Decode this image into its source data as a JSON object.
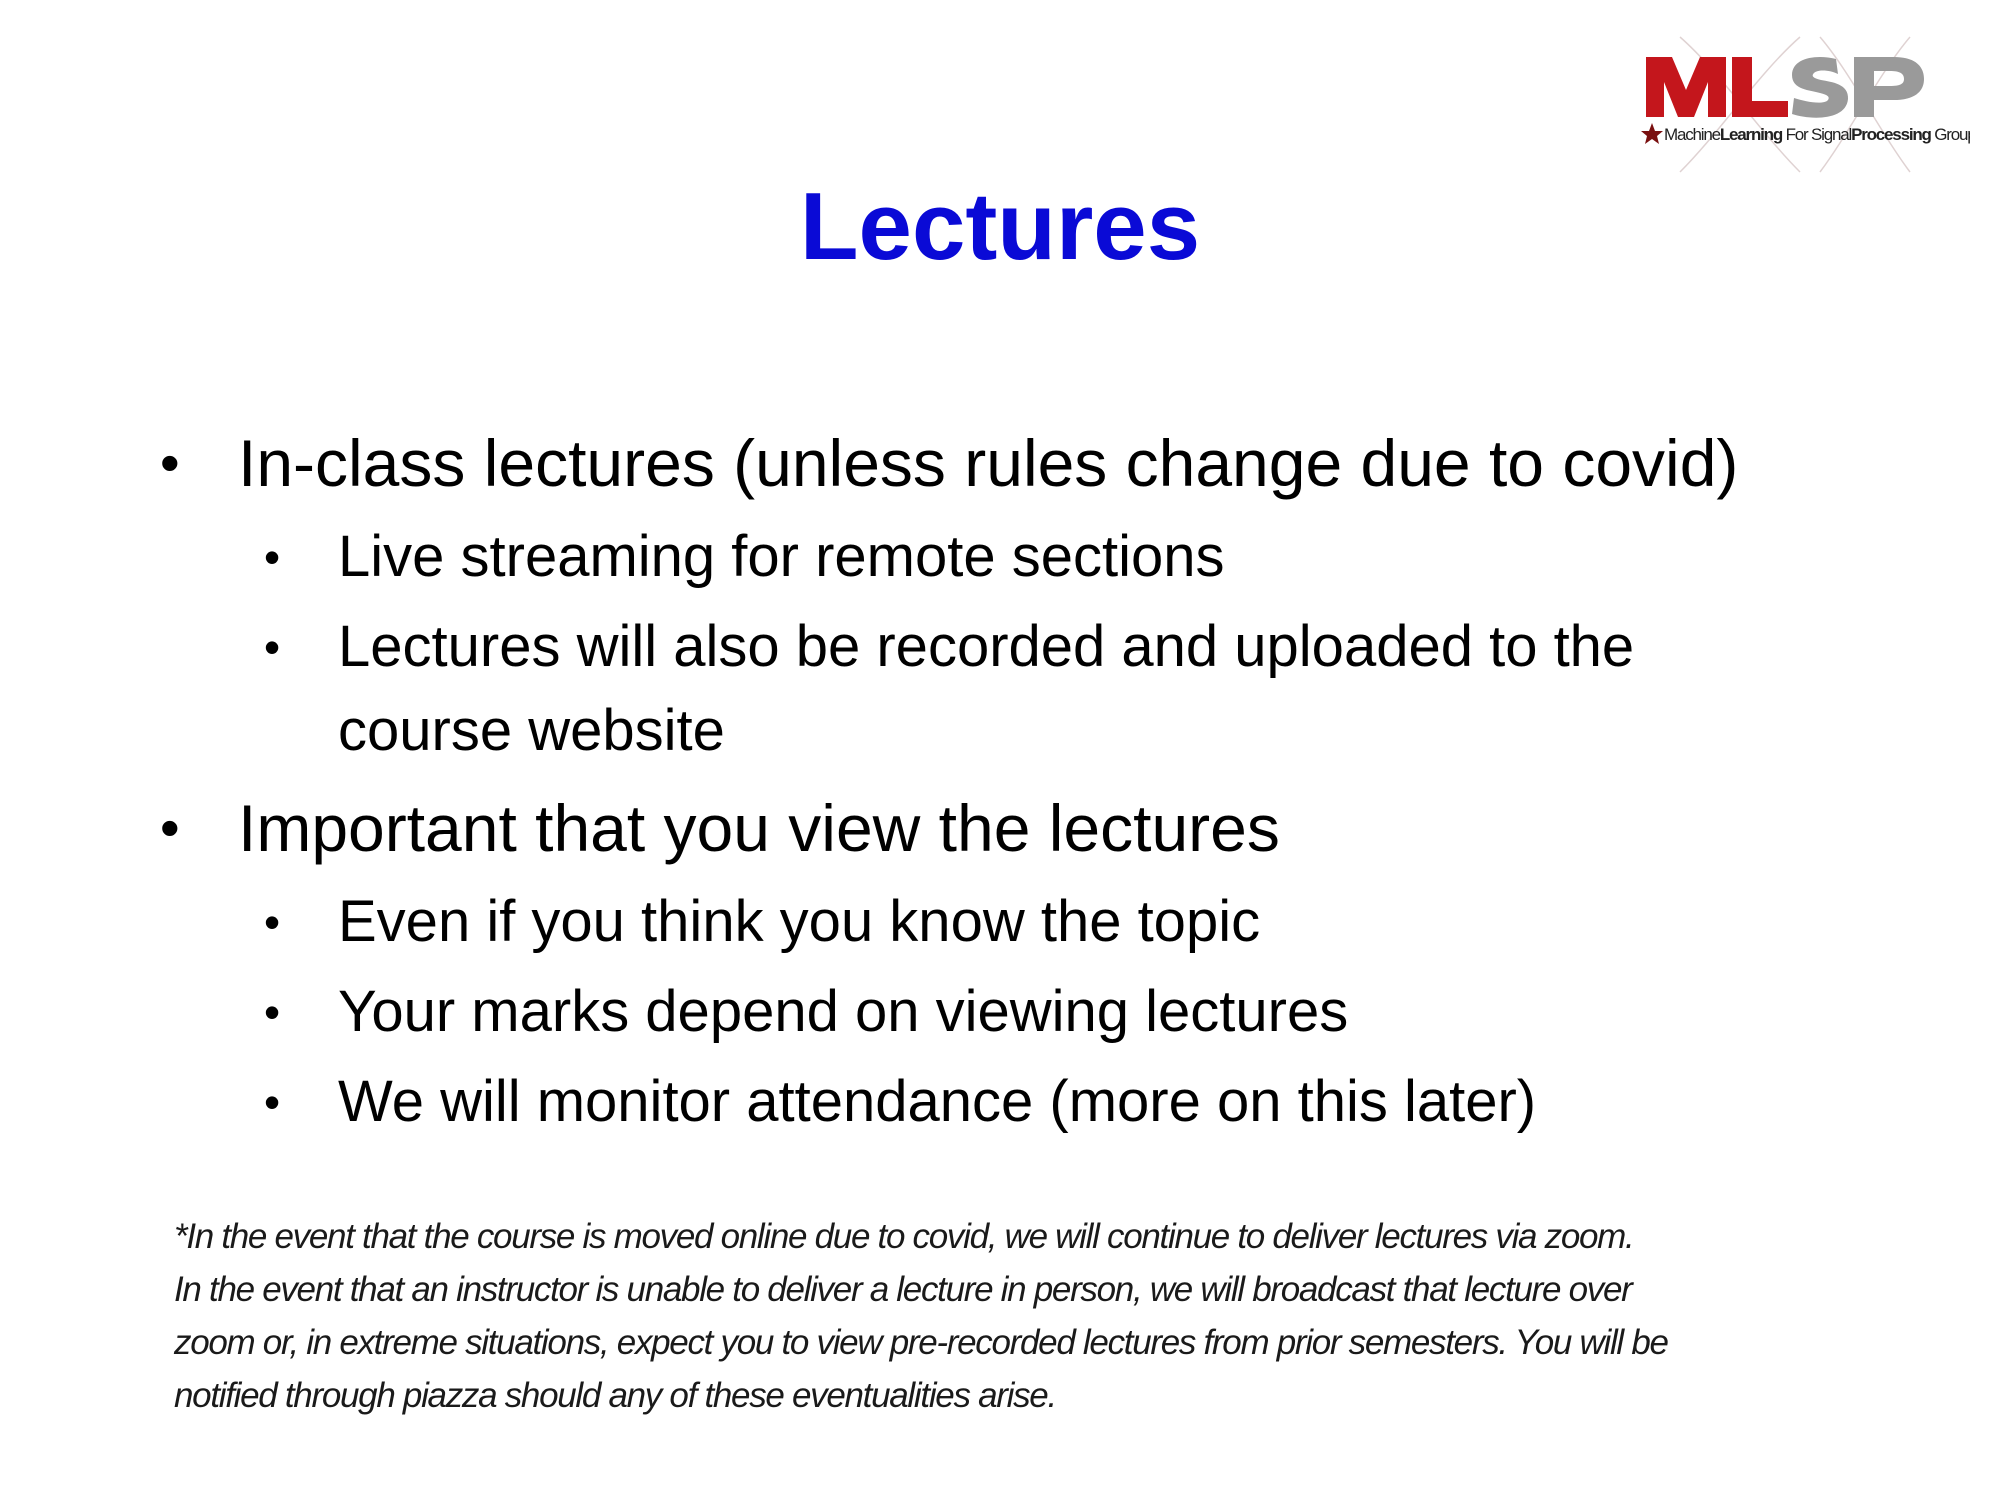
{
  "slide": {
    "title": "Lectures",
    "logo": {
      "name": "MLSP",
      "tagline_parts": [
        "Machine",
        "Learning",
        " For Signal",
        "Processing",
        " Group"
      ],
      "colors": {
        "red": "#c4161c",
        "gray": "#9a9a9a",
        "dark": "#222222"
      }
    },
    "bullets": [
      {
        "text": "In-class lectures (unless rules change due to covid)",
        "subs": [
          {
            "lines": [
              "Live streaming for remote sections"
            ]
          },
          {
            "lines": [
              "Lectures will also be recorded and uploaded to the",
              "course website"
            ]
          }
        ]
      },
      {
        "text": "Important that you view the lectures",
        "subs": [
          {
            "lines": [
              "Even if you think you know the topic"
            ]
          },
          {
            "lines": [
              "Your marks depend on viewing lectures"
            ]
          },
          {
            "lines": [
              "We will monitor attendance (more on this later)"
            ]
          }
        ]
      }
    ],
    "bullet_glyph": "•",
    "footnote": [
      "*In  the event that the course is moved online due to covid, we will continue to deliver lectures via zoom.",
      "In the event that an instructor is unable to deliver a  lecture in person, we will broadcast that lecture over",
      "zoom or, in extreme situations, expect you to view pre-recorded lectures from prior semesters. You will be",
      "notified through piazza should any of these eventualities arise."
    ],
    "title_color": "#0a0ad6"
  }
}
